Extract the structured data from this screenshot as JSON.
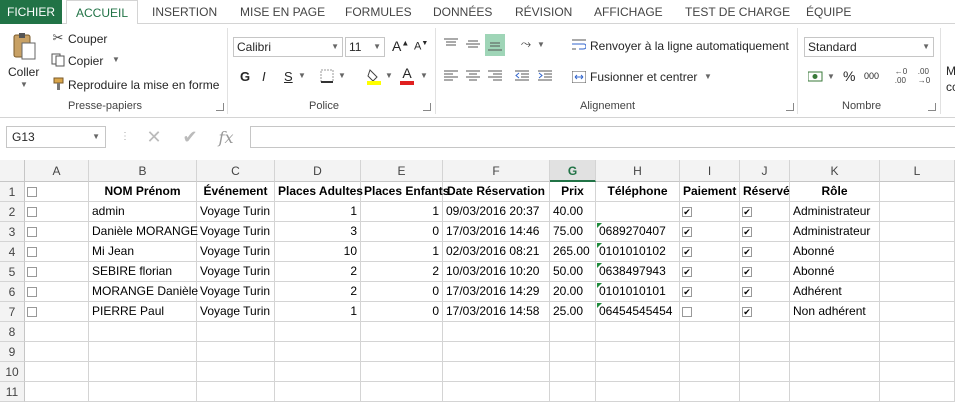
{
  "tabs": [
    "FICHIER",
    "ACCUEIL",
    "INSERTION",
    "MISE EN PAGE",
    "FORMULES",
    "DONNÉES",
    "RÉVISION",
    "AFFICHAGE",
    "TEST DE CHARGE",
    "ÉQUIPE"
  ],
  "clipboard": {
    "paste": "Coller",
    "cut": "Couper",
    "copy": "Copier",
    "format_painter": "Reproduire la mise en forme",
    "label": "Presse-papiers"
  },
  "font": {
    "name": "Calibri",
    "size": "11",
    "bold": "G",
    "italic": "I",
    "underline": "S",
    "grow": "A",
    "shrink": "A",
    "color_letter": "A",
    "label": "Police"
  },
  "alignment": {
    "wrap": "Renvoyer à la ligne automatiquement",
    "merge": "Fusionner et centrer",
    "label": "Alignement"
  },
  "number": {
    "format": "Standard",
    "percent": "%",
    "thousands": "000",
    "label": "Nombre",
    "cut_text": "M",
    "cut_text2": "cc"
  },
  "formula_bar": {
    "name_box": "G13",
    "fx": "fx"
  },
  "columns": [
    "A",
    "B",
    "C",
    "D",
    "E",
    "F",
    "G",
    "H",
    "I",
    "J",
    "K",
    "L"
  ],
  "rows": [
    "1",
    "2",
    "3",
    "4",
    "5",
    "6",
    "7",
    "8",
    "9",
    "10",
    "11"
  ],
  "headers": [
    "NOM Prénom",
    "Événement",
    "Places Adultes",
    "Places Enfants",
    "Date Réservation",
    "Prix",
    "Téléphone",
    "Paiement",
    "Réservé",
    "Rôle"
  ],
  "records": [
    {
      "name": "admin",
      "event": "Voyage Turin",
      "adults": "1",
      "children": "1",
      "date": "09/03/2016 20:37",
      "price": "40.00",
      "phone": "",
      "paid": true,
      "reserved": true,
      "role": "Administrateur"
    },
    {
      "name": "Danièle MORANGE",
      "event": "Voyage Turin",
      "adults": "3",
      "children": "0",
      "date": "17/03/2016 14:46",
      "price": "75.00",
      "phone": "0689270407",
      "paid": true,
      "reserved": true,
      "role": "Administrateur"
    },
    {
      "name": "Mi Jean",
      "event": "Voyage Turin",
      "adults": "10",
      "children": "1",
      "date": "02/03/2016 08:21",
      "price": "265.00",
      "phone": "0101010102",
      "paid": true,
      "reserved": true,
      "role": "Abonné"
    },
    {
      "name": "SEBIRE florian",
      "event": "Voyage Turin",
      "adults": "2",
      "children": "2",
      "date": "10/03/2016 10:20",
      "price": "50.00",
      "phone": "0638497943",
      "paid": true,
      "reserved": true,
      "role": "Abonné"
    },
    {
      "name": "MORANGE Danièle",
      "event": "Voyage Turin",
      "adults": "2",
      "children": "0",
      "date": "17/03/2016 14:29",
      "price": "20.00",
      "phone": "0101010101",
      "paid": true,
      "reserved": true,
      "role": "Adhérent"
    },
    {
      "name": "PIERRE Paul",
      "event": "Voyage Turin",
      "adults": "1",
      "children": "0",
      "date": "17/03/2016 14:58",
      "price": "25.00",
      "phone": "06454545454",
      "paid": false,
      "reserved": true,
      "role": "Non adhérent"
    }
  ],
  "colors": {
    "accent": "#217346",
    "selected_col_header": "#e1e1e1",
    "error_triangle": "#1e8a3b"
  }
}
